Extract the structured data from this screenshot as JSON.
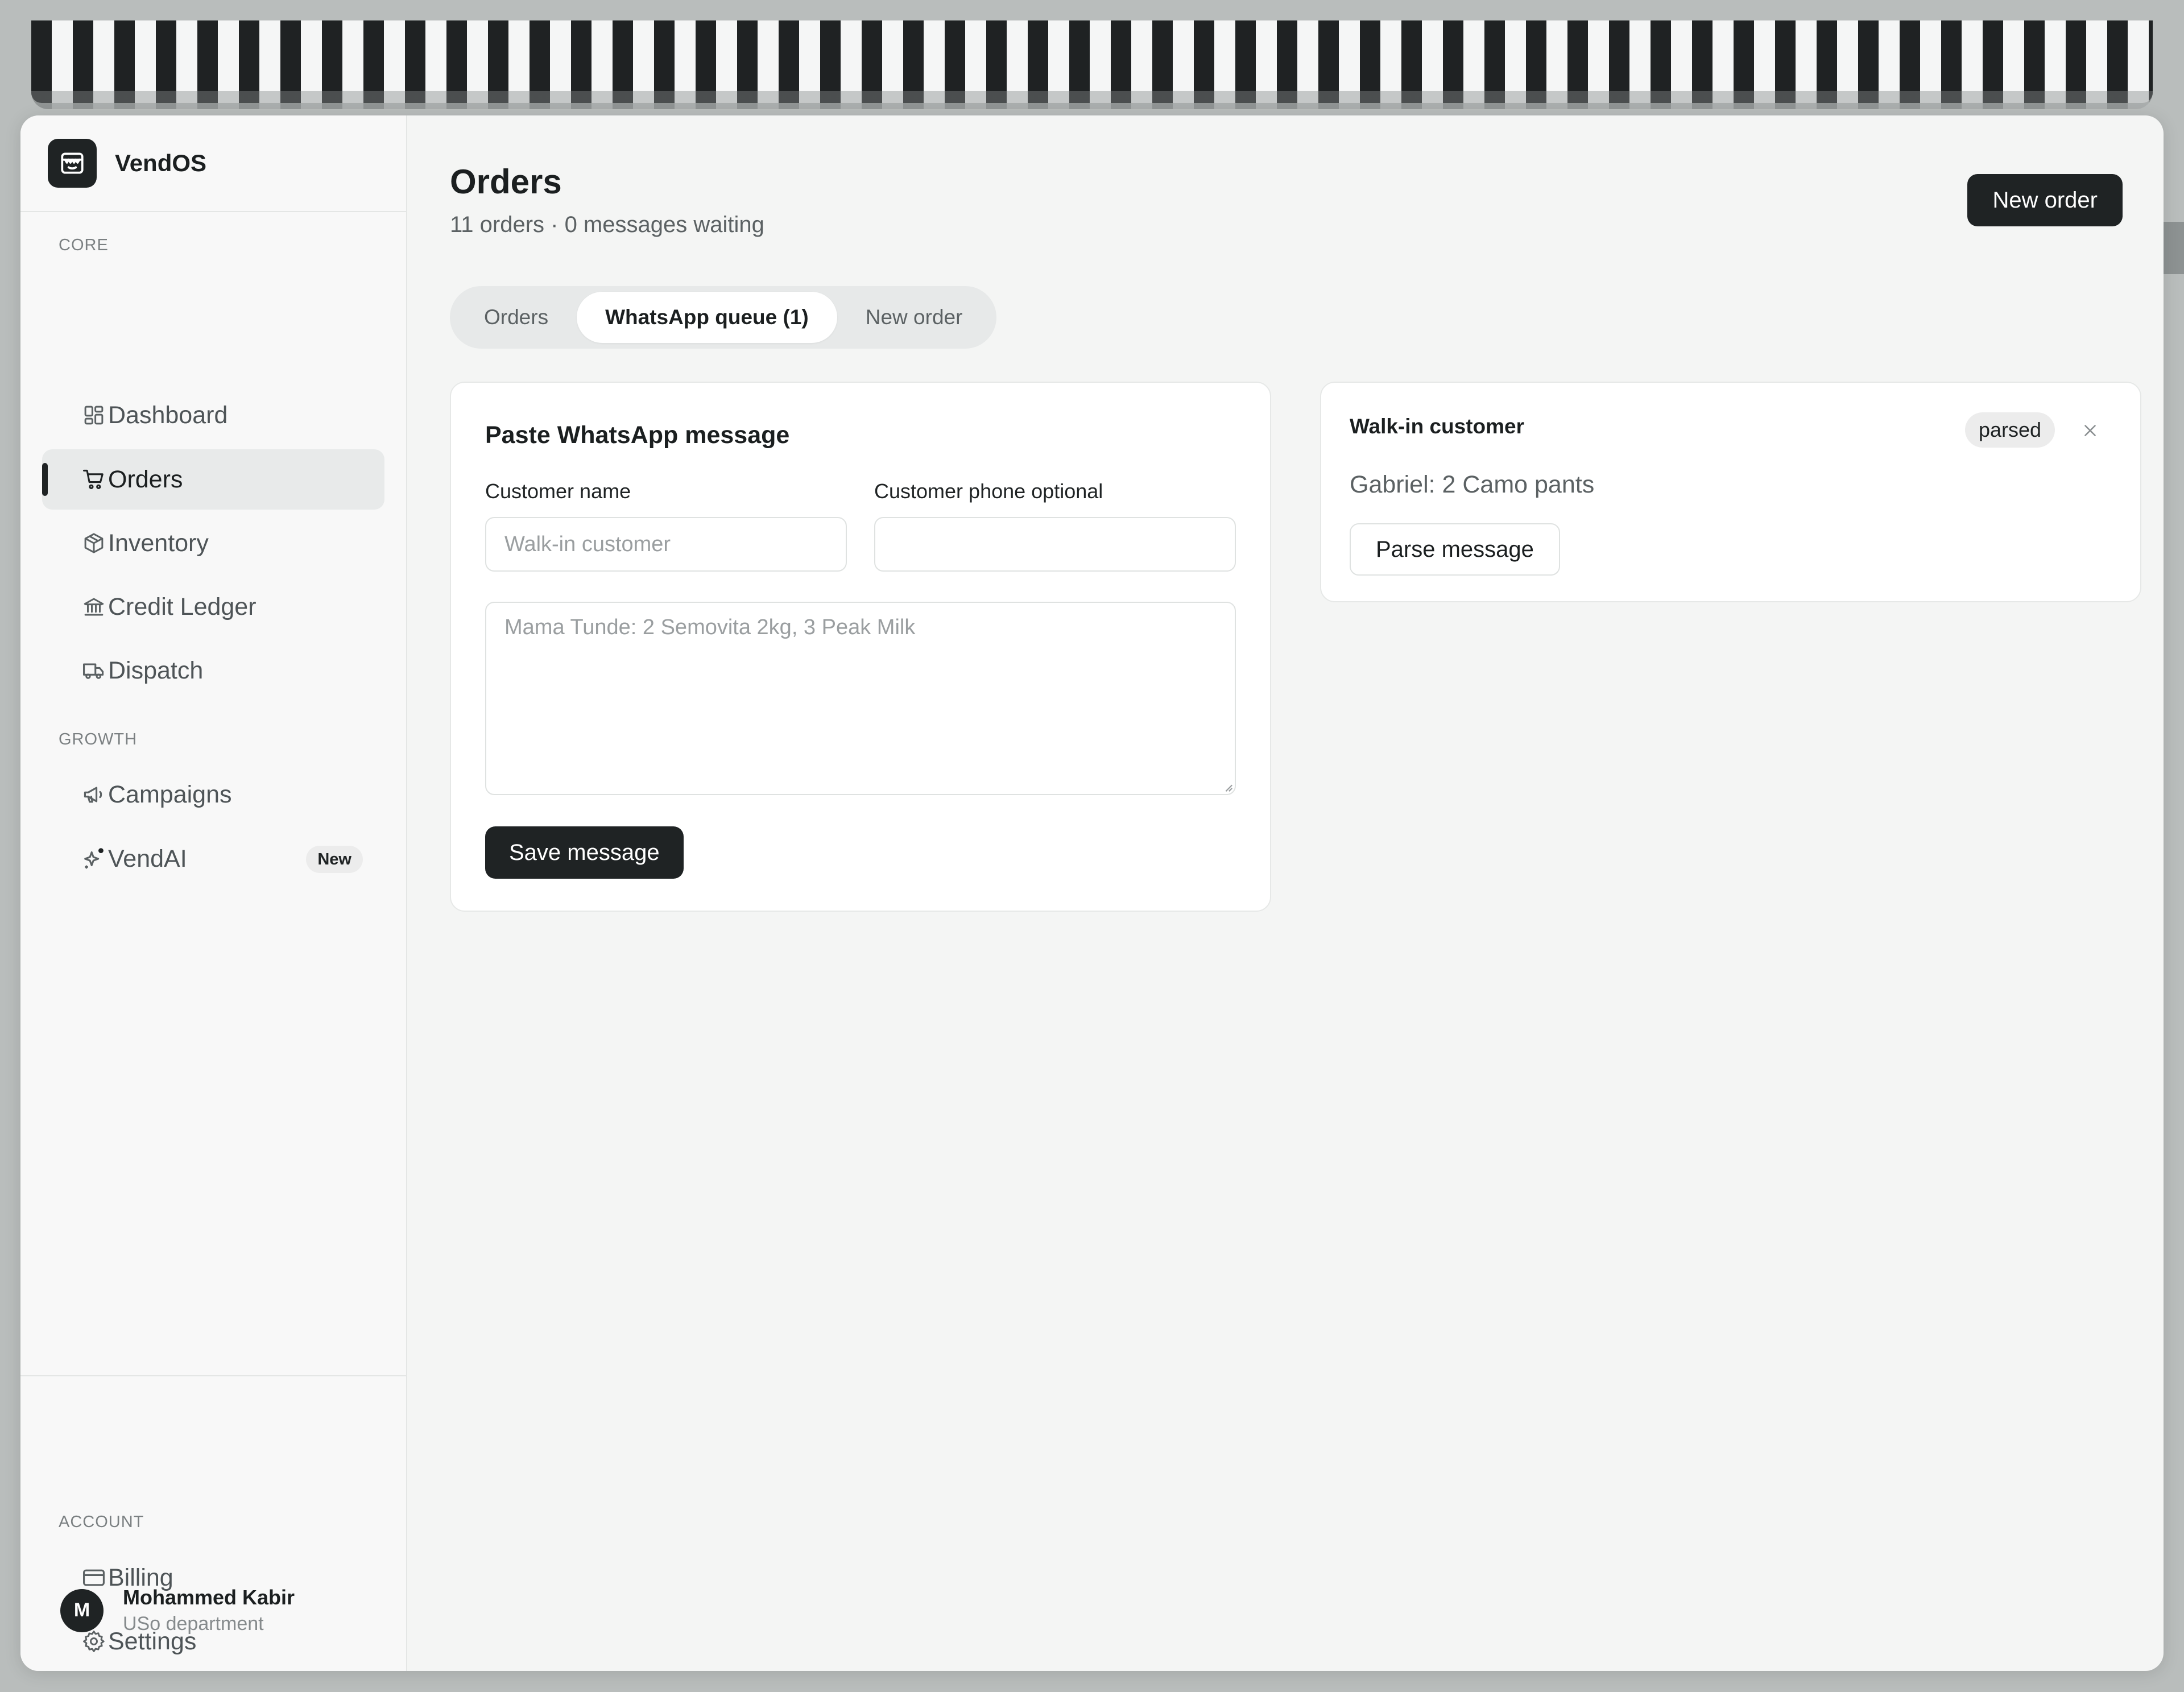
{
  "brand": {
    "name": "VendOS"
  },
  "sidebar": {
    "sections": {
      "core": "CORE",
      "growth": "GROWTH",
      "account": "ACCOUNT"
    },
    "items": [
      {
        "label": "Dashboard",
        "icon": "dashboard-icon"
      },
      {
        "label": "Orders",
        "icon": "cart-icon",
        "active": true
      },
      {
        "label": "Inventory",
        "icon": "box-icon"
      },
      {
        "label": "Credit Ledger",
        "icon": "bank-icon"
      },
      {
        "label": "Dispatch",
        "icon": "truck-icon"
      },
      {
        "label": "Campaigns",
        "icon": "megaphone-icon"
      },
      {
        "label": "VendAI",
        "icon": "sparkle-icon",
        "badge": "New"
      },
      {
        "label": "Billing",
        "icon": "credit-card-icon"
      },
      {
        "label": "Settings",
        "icon": "gear-icon"
      }
    ],
    "profile": {
      "initial": "M",
      "name": "Mohammed Kabir",
      "org": "USo department"
    }
  },
  "header": {
    "title": "Orders",
    "subtitle": "11 orders · 0 messages waiting",
    "new_order_label": "New order"
  },
  "tabs": [
    {
      "label": "Orders"
    },
    {
      "label": "WhatsApp queue (1)",
      "active": true
    },
    {
      "label": "New order"
    }
  ],
  "paste_form": {
    "title": "Paste WhatsApp message",
    "customer_name_label": "Customer name",
    "customer_name_placeholder": "Walk-in customer",
    "customer_phone_label": "Customer phone optional",
    "customer_phone_placeholder": "",
    "message_placeholder": "Mama Tunde: 2 Semovita 2kg, 3 Peak Milk",
    "save_label": "Save message"
  },
  "queue_item": {
    "customer": "Walk-in customer",
    "status": "parsed",
    "message": "Gabriel: 2 Camo pants",
    "parse_label": "Parse message"
  },
  "colors": {
    "accent": "#1f2324",
    "background": "#f4f5f4",
    "muted_text": "#5b6163"
  }
}
